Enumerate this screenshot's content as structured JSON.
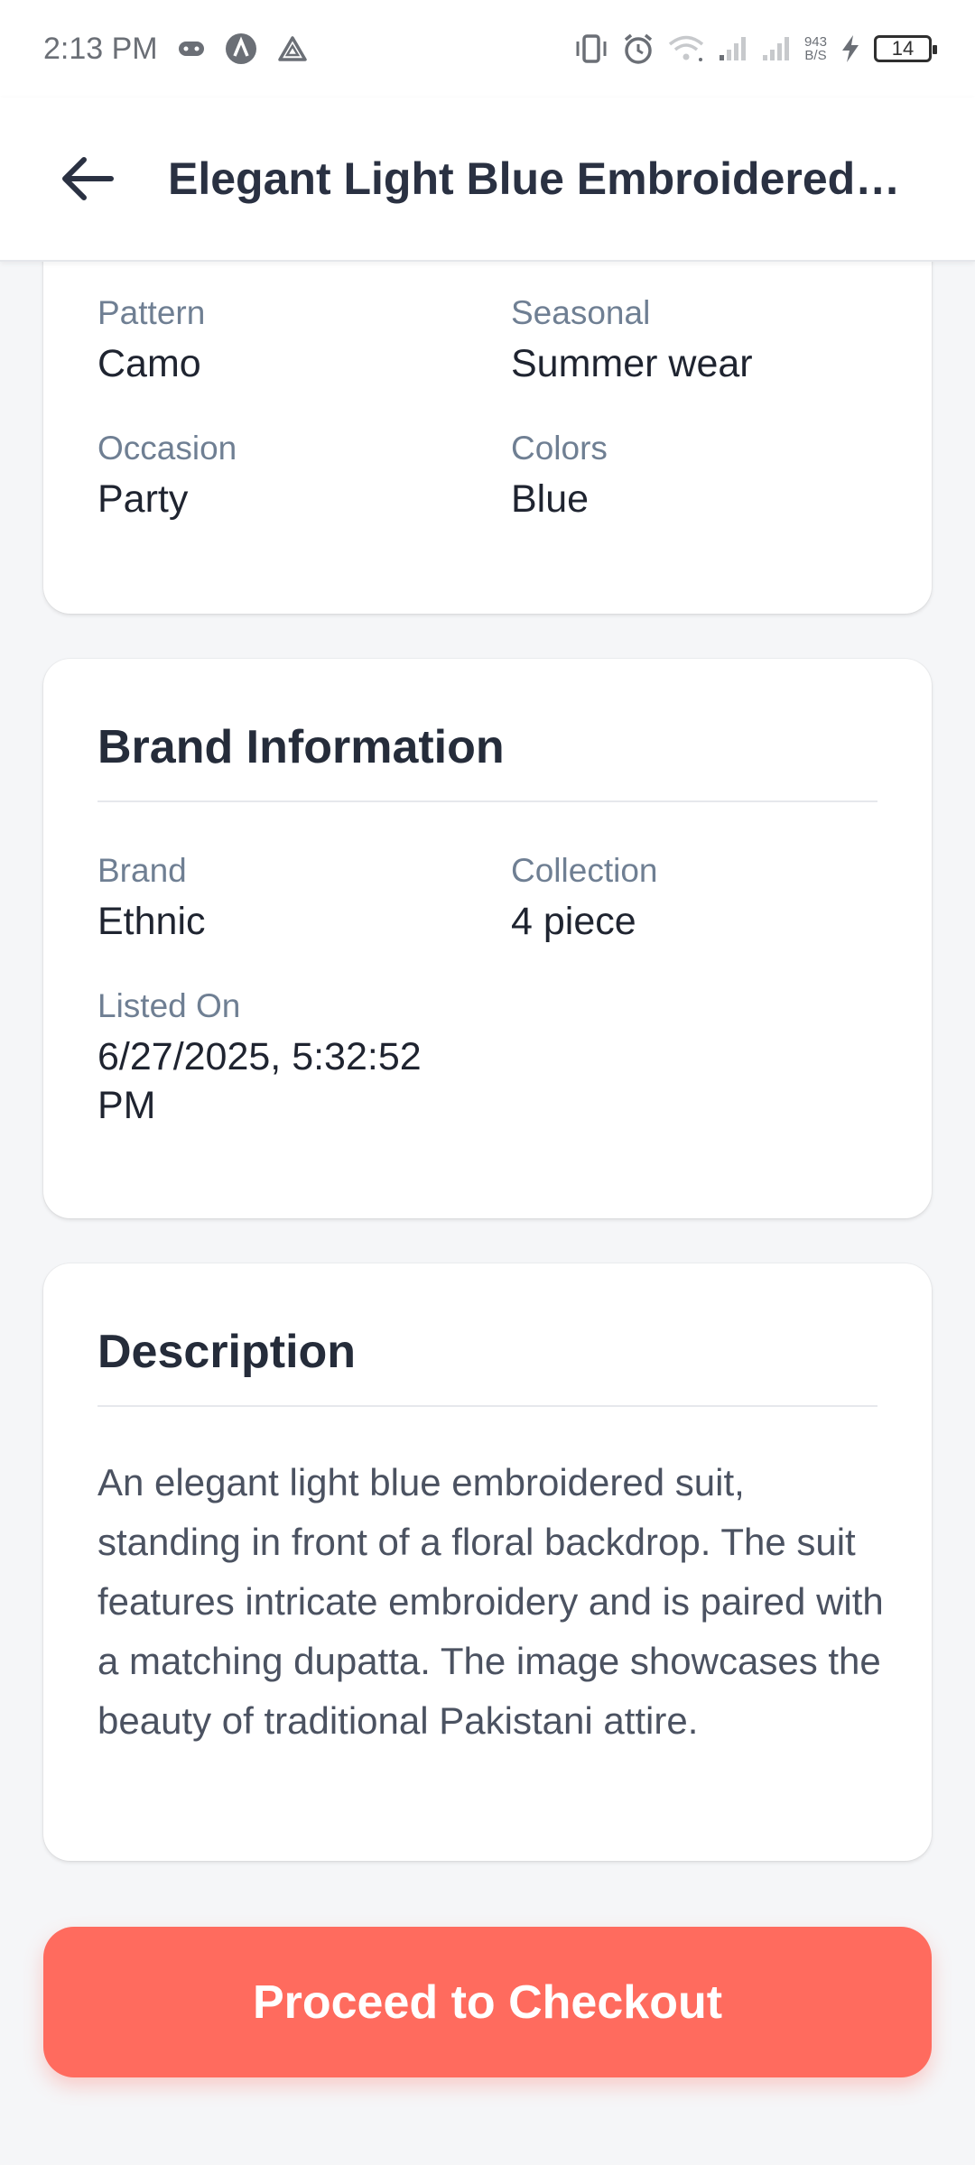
{
  "status_bar": {
    "time": "2:13 PM",
    "net_speed_value": "943",
    "net_speed_unit": "B/S",
    "battery": "14",
    "icons": [
      "gamepad-icon",
      "a-circle-icon",
      "triangle-icon",
      "vibrate-icon",
      "alarm-icon",
      "wifi-icon",
      "signal-icon",
      "signal-icon",
      "charging-icon"
    ]
  },
  "header": {
    "back_icon": "back-arrow-icon",
    "title": "Elegant Light Blue Embroidered …"
  },
  "attributes": {
    "pattern_label": "Pattern",
    "pattern_value": "Camo",
    "seasonal_label": "Seasonal",
    "seasonal_value": "Summer wear",
    "occasion_label": "Occasion",
    "occasion_value": "Party",
    "colors_label": "Colors",
    "colors_value": "Blue"
  },
  "brand_info": {
    "title": "Brand Information",
    "brand_label": "Brand",
    "brand_value": "Ethnic",
    "collection_label": "Collection",
    "collection_value": "4 piece",
    "listed_label": "Listed On",
    "listed_value_line1": "6/27/2025, 5:32:52",
    "listed_value_line2": "PM"
  },
  "description": {
    "title": "Description",
    "text": "An elegant light blue embroidered suit, standing in front of a floral backdrop. The suit features intricate embroidery and is paired with a matching dupatta. The image showcases the beauty of traditional Pakistani attire."
  },
  "checkout": {
    "label": "Proceed to Checkout",
    "color": "#ff6b5e"
  }
}
